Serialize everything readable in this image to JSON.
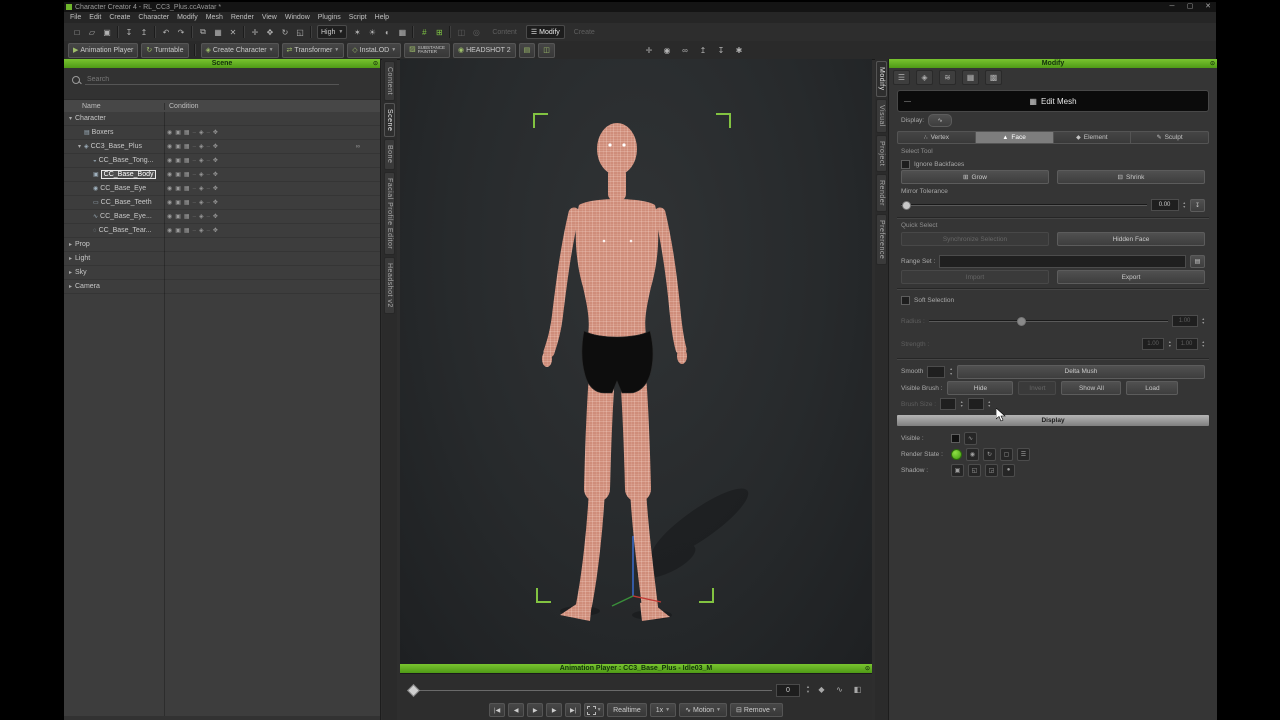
{
  "window": {
    "title": "Character Creator 4 - RL_CC3_Plus.ccAvatar *",
    "controls": [
      {
        "name": "minimize-button",
        "glyph": "─"
      },
      {
        "name": "maximize-button",
        "glyph": "▢"
      },
      {
        "name": "close-button",
        "glyph": "✕"
      }
    ]
  },
  "menubar": [
    "File",
    "Edit",
    "Create",
    "Character",
    "Modify",
    "Mesh",
    "Render",
    "View",
    "Window",
    "Plugins",
    "Script",
    "Help"
  ],
  "toolbar1": {
    "icons": [
      {
        "name": "new-project-icon",
        "glyph": "□"
      },
      {
        "name": "open-project-icon",
        "glyph": "▱"
      },
      {
        "name": "save-icon",
        "glyph": "▣"
      },
      {
        "sep": true
      },
      {
        "name": "import-icon",
        "glyph": "↧"
      },
      {
        "name": "export-icon",
        "glyph": "↥"
      },
      {
        "sep": true
      },
      {
        "name": "undo-icon",
        "glyph": "↶"
      },
      {
        "name": "redo-icon",
        "glyph": "↷"
      },
      {
        "sep": true
      },
      {
        "name": "copy-icon",
        "glyph": "⧉"
      },
      {
        "name": "paste-icon",
        "glyph": "▦"
      },
      {
        "name": "delete-icon",
        "glyph": "✕"
      },
      {
        "sep": true
      },
      {
        "name": "select-tool-icon",
        "glyph": "✛"
      },
      {
        "name": "move-tool-icon",
        "glyph": "✥"
      },
      {
        "name": "rotate-tool-icon",
        "glyph": "↻"
      },
      {
        "name": "scale-tool-icon",
        "glyph": "◱"
      },
      {
        "sep": true
      }
    ],
    "quality": {
      "value": "High"
    },
    "icons2": [
      {
        "name": "render-icon",
        "glyph": "✶"
      },
      {
        "name": "light-icon",
        "glyph": "☀"
      },
      {
        "name": "shading-icon",
        "glyph": "◐"
      },
      {
        "name": "wireframe-icon",
        "glyph": "▦"
      },
      {
        "sep": true
      },
      {
        "name": "snap-icon",
        "glyph": "#",
        "green": true
      },
      {
        "name": "grid-icon",
        "glyph": "⊞",
        "green": true
      },
      {
        "sep": true
      },
      {
        "name": "mirror-icon",
        "glyph": "◫",
        "dim": true
      },
      {
        "name": "probe-icon",
        "glyph": "◎",
        "dim": true
      }
    ],
    "panel_toggles": [
      {
        "name": "content-toggle",
        "label": "Content",
        "dim": true
      },
      {
        "name": "modify-toggle",
        "label": "Modify",
        "glyph": "☰",
        "active": true
      },
      {
        "name": "create-toggle",
        "label": "Create",
        "dim": true
      }
    ]
  },
  "toolbar2": {
    "buttons": [
      {
        "name": "animation-player-button",
        "label": "Animation Player",
        "glyph": "▶"
      },
      {
        "name": "turntable-button",
        "label": "Turntable",
        "glyph": "↻"
      },
      {
        "sep": true
      },
      {
        "name": "create-character-button",
        "label": "Create Character",
        "glyph": "◈",
        "caret": true
      },
      {
        "name": "transformer-button",
        "label": "Transformer",
        "glyph": "⇄",
        "caret": true
      },
      {
        "name": "instalod-button",
        "label": "InstaLOD",
        "glyph": "◇",
        "caret": true
      },
      {
        "name": "substance-painter-button",
        "label": "SUBSTANCE PAINTER",
        "glyph": "▨",
        "small": true
      },
      {
        "name": "headshot2-button",
        "label": "HEADSHOT 2",
        "glyph": "◉"
      },
      {
        "name": "pose-tool-icon",
        "glyph": "▤",
        "icononly": true,
        "dim": true
      },
      {
        "name": "calibration-tool-icon",
        "glyph": "◫",
        "icononly": true,
        "dim": true
      }
    ],
    "right_icons": [
      {
        "name": "focus-icon",
        "glyph": "✛"
      },
      {
        "name": "visibility-icon",
        "glyph": "◉"
      },
      {
        "name": "link-icon",
        "glyph": "∞"
      },
      {
        "name": "export-scene-icon",
        "glyph": "↥"
      },
      {
        "name": "import-scene-icon",
        "glyph": "↧"
      },
      {
        "name": "settings-icon",
        "glyph": "✱"
      }
    ]
  },
  "left_tabs": [
    {
      "label": "Content"
    },
    {
      "label": "Scene",
      "active": true
    },
    {
      "label": "Bone"
    },
    {
      "label": "Facial Profile Editor"
    },
    {
      "label": "Headshot v2"
    }
  ],
  "right_tabs": [
    {
      "label": "Modify",
      "active": true
    },
    {
      "label": "Visual"
    },
    {
      "label": "Project"
    },
    {
      "label": "Render"
    },
    {
      "label": "Preference"
    }
  ],
  "scene": {
    "title": "Scene",
    "close_glyph": "⊙",
    "search_placeholder": "Search",
    "columns": [
      "Name",
      "Condition"
    ],
    "condition_icons": [
      {
        "name": "visibility-icon",
        "glyph": "◉"
      },
      {
        "name": "select-state-icon",
        "glyph": "▣"
      },
      {
        "name": "mesh-state-icon",
        "glyph": "▦"
      },
      {
        "name": "dash",
        "glyph": "–"
      },
      {
        "name": "material-state-icon",
        "glyph": "◈"
      },
      {
        "name": "dash",
        "glyph": "–"
      },
      {
        "name": "physics-state-icon",
        "glyph": "✥"
      }
    ],
    "rows": [
      {
        "name": "Character",
        "depth": 0,
        "arrow": "open"
      },
      {
        "name": "Boxers",
        "depth": 1,
        "glyph": "▤",
        "icons": true
      },
      {
        "name": "CC3_Base_Plus",
        "depth": 1,
        "arrow": "open",
        "glyph": "◈",
        "icons": true,
        "link": true
      },
      {
        "name": "CC_Base_Tong...",
        "depth": 2,
        "glyph": "◒",
        "icons": true
      },
      {
        "name": "CC_Base_Body",
        "depth": 2,
        "glyph": "▣",
        "icons": true,
        "selected": true
      },
      {
        "name": "CC_Base_Eye",
        "depth": 2,
        "glyph": "◉",
        "icons": true
      },
      {
        "name": "CC_Base_Teeth",
        "depth": 2,
        "glyph": "▭",
        "icons": true
      },
      {
        "name": "CC_Base_Eye...",
        "depth": 2,
        "glyph": "∿",
        "icons": true
      },
      {
        "name": "CC_Base_Tear...",
        "depth": 2,
        "glyph": "◌",
        "icons": true
      },
      {
        "name": "Prop",
        "depth": 0,
        "arrow": "closed"
      },
      {
        "name": "Light",
        "depth": 0,
        "arrow": "closed"
      },
      {
        "name": "Sky",
        "depth": 0,
        "arrow": "closed"
      },
      {
        "name": "Camera",
        "depth": 0,
        "arrow": "closed"
      }
    ]
  },
  "viewport": {
    "marker_color": "#82c341"
  },
  "modify": {
    "title": "Modify",
    "close_glyph": "⊙",
    "icon_tabs": [
      {
        "name": "attribute-tab-icon",
        "glyph": "☰"
      },
      {
        "name": "character-tab-icon",
        "glyph": "◈"
      },
      {
        "name": "adjust-tab-icon",
        "glyph": "≋"
      },
      {
        "name": "mesh-tab-icon",
        "glyph": "▦"
      },
      {
        "name": "texture-tab-icon",
        "glyph": "▩"
      }
    ],
    "edit_mesh": {
      "label": "Edit Mesh",
      "collapse_glyph": "—",
      "icon_glyph": "▦"
    },
    "display_label": "Display:",
    "mode_tabs": [
      {
        "label": "Vertex",
        "glyph": "∴"
      },
      {
        "label": "Face",
        "glyph": "▲",
        "active": true
      },
      {
        "label": "Element",
        "glyph": "◆"
      },
      {
        "label": "Sculpt",
        "glyph": "✎"
      }
    ],
    "select_tool": {
      "label": "Select Tool",
      "ignore_backfaces": "Ignore Backfaces",
      "grow": "Grow",
      "shrink": "Shrink",
      "mirror_tolerance_label": "Mirror Tolerance",
      "mirror_tolerance_value": "0.00"
    },
    "quick_select": {
      "label": "Quick Select",
      "left_button": "Synchronize Selection",
      "right_button": "Hidden Face",
      "range_set_label": "Range Set :",
      "import_label": "Import",
      "export_label": "Export"
    },
    "soft_selection": {
      "label": "Soft Selection",
      "radius_label": "Radius :",
      "radius_value": "1.00",
      "strength_label": "Strength :",
      "strength_v1": "1.00",
      "strength_v2": "1.00"
    },
    "smooth": {
      "label": "Smooth",
      "delta_mush": "Delta Mush"
    },
    "visible_brush": {
      "label": "Visible Brush :",
      "buttons": [
        {
          "label": "Hide"
        },
        {
          "label": "Invert",
          "disabled": true
        },
        {
          "label": "Show All"
        },
        {
          "label": "Load"
        }
      ],
      "brush_size_label": "Brush Size :"
    },
    "display_section": {
      "header": "Display",
      "visible_label": "Visible :",
      "render_state_label": "Render State :",
      "shadow_label": "Shadow :",
      "render_state_icons": [
        {
          "name": "material-ball-icon",
          "glyph": "◉"
        },
        {
          "name": "refresh-icon",
          "glyph": "↻"
        },
        {
          "name": "bounding-box-icon",
          "glyph": "▢"
        },
        {
          "name": "layers-icon",
          "glyph": "☰"
        }
      ],
      "shadow_icons": [
        {
          "name": "cast-shadow-icon",
          "glyph": "▣"
        },
        {
          "name": "receive-shadow-icon",
          "glyph": "◱"
        },
        {
          "name": "self-shadow-icon",
          "glyph": "◲"
        },
        {
          "name": "shadow-only-icon",
          "glyph": "●"
        }
      ]
    }
  },
  "animation_player": {
    "title": "Animation Player : CC3_Base_Plus - Idle03_M",
    "close_glyph": "⊙",
    "frame_value": "0",
    "transport": [
      {
        "name": "go-start-button",
        "glyph": "|◀"
      },
      {
        "name": "prev-frame-button",
        "glyph": "◀"
      },
      {
        "name": "play-button",
        "glyph": "▶"
      },
      {
        "name": "next-frame-button",
        "glyph": "▶"
      },
      {
        "name": "go-end-button",
        "glyph": "▶|"
      }
    ],
    "realtime_label": "Realtime",
    "speed_label": "1x",
    "motion_label": "Motion",
    "remove_label": "Remove",
    "timeline_icons": [
      {
        "name": "keyframe-icon",
        "glyph": "◆"
      },
      {
        "name": "curve-icon",
        "glyph": "∿"
      },
      {
        "name": "clapper-icon",
        "glyph": "◧"
      }
    ]
  }
}
